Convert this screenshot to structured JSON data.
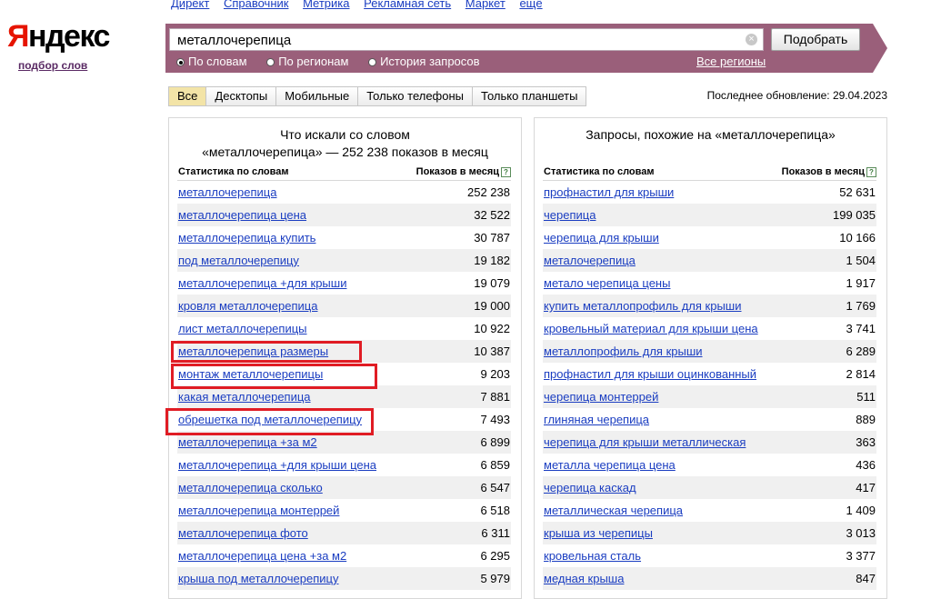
{
  "topnav": [
    "Директ",
    "Справочник",
    "Метрика",
    "Рекламная сеть",
    "Маркет",
    "ещё"
  ],
  "logo": {
    "first_letter": "Я",
    "rest": "ндекс",
    "subtitle": "подбор слов"
  },
  "search": {
    "value": "металлочерепица",
    "clear_symbol": "⊗",
    "button": "Подобрать"
  },
  "modes": [
    {
      "label": "По словам",
      "selected": true
    },
    {
      "label": "По регионам",
      "selected": false
    },
    {
      "label": "История запросов",
      "selected": false
    }
  ],
  "regions_link": "Все регионы",
  "tabs": [
    {
      "label": "Все",
      "active": true
    },
    {
      "label": "Десктопы",
      "active": false
    },
    {
      "label": "Мобильные",
      "active": false
    },
    {
      "label": "Только телефоны",
      "active": false
    },
    {
      "label": "Только планшеты",
      "active": false
    }
  ],
  "last_update": "Последнее обновление: 29.04.2023",
  "left_panel": {
    "title_line1": "Что искали со словом",
    "title_line2": "«металлочерепица» — 252 238 показов в месяц",
    "col_keyword": "Статистика по словам",
    "col_count": "Показов в месяц",
    "help_icon": "?",
    "rows": [
      {
        "kw": "металлочерепица",
        "count": "252 238"
      },
      {
        "kw": "металлочерепица цена",
        "count": "32 522"
      },
      {
        "kw": "металлочерепица купить",
        "count": "30 787"
      },
      {
        "kw": "под металлочерепицу",
        "count": "19 182"
      },
      {
        "kw": "металлочерепица +для крыши",
        "count": "19 079"
      },
      {
        "kw": "кровля металлочерепица",
        "count": "19 000"
      },
      {
        "kw": "лист металлочерепицы",
        "count": "10 922"
      },
      {
        "kw": "металлочерепица размеры",
        "count": "10 387"
      },
      {
        "kw": "монтаж металлочерепицы",
        "count": "9 203"
      },
      {
        "kw": "какая металлочерепица",
        "count": "7 881"
      },
      {
        "kw": "обрешетка под металлочерепицу",
        "count": "7 493"
      },
      {
        "kw": "металлочерепица +за м2",
        "count": "6 899"
      },
      {
        "kw": "металлочерепица +для крыши цена",
        "count": "6 859"
      },
      {
        "kw": "металлочерепица сколько",
        "count": "6 547"
      },
      {
        "kw": "металлочерепица монтеррей",
        "count": "6 518"
      },
      {
        "kw": "металлочерепица фото",
        "count": "6 311"
      },
      {
        "kw": "металлочерепица цена +за м2",
        "count": "6 295"
      },
      {
        "kw": "крыша под металлочерепицу",
        "count": "5 979"
      }
    ]
  },
  "right_panel": {
    "title_line1": "Запросы, похожие на «металлочерепица»",
    "col_keyword": "Статистика по словам",
    "col_count": "Показов в месяц",
    "help_icon": "?",
    "rows": [
      {
        "kw": "профнастил для крыши",
        "count": "52 631"
      },
      {
        "kw": "черепица",
        "count": "199 035"
      },
      {
        "kw": "черепица для крыши",
        "count": "10 166"
      },
      {
        "kw": "металочерепица",
        "count": "1 504"
      },
      {
        "kw": "метало черепица цены",
        "count": "1 917"
      },
      {
        "kw": "купить металлопрофиль для крыши",
        "count": "1 769"
      },
      {
        "kw": "кровельный материал для крыши цена",
        "count": "3 741"
      },
      {
        "kw": "металлопрофиль для крыши",
        "count": "6 289"
      },
      {
        "kw": "профнастил для крыши оцинкованный",
        "count": "2 814"
      },
      {
        "kw": "черепица монтеррей",
        "count": "511"
      },
      {
        "kw": "глиняная черепица",
        "count": "889"
      },
      {
        "kw": "черепица для крыши металлическая",
        "count": "363"
      },
      {
        "kw": "металла черепица цена",
        "count": "436"
      },
      {
        "kw": "черепица каскад",
        "count": "417"
      },
      {
        "kw": "металлическая черепица",
        "count": "1 409"
      },
      {
        "kw": "крыша из черепицы",
        "count": "3 013"
      },
      {
        "kw": "кровельная сталь",
        "count": "3 377"
      },
      {
        "kw": "медная крыша",
        "count": "847"
      }
    ]
  },
  "colors": {
    "accent_bar": "#9a5f7a",
    "link": "#1a3dc1",
    "highlight_box": "#e01c24",
    "logo_red": "#e61400"
  }
}
